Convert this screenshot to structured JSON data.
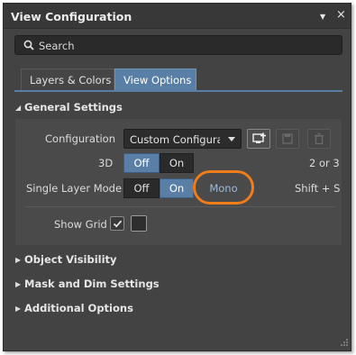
{
  "panel": {
    "title": "View Configuration",
    "controls": {
      "pin": "▼",
      "close": "×"
    }
  },
  "search": {
    "placeholder": "Search"
  },
  "tabs": [
    {
      "label": "Layers & Colors",
      "active": false
    },
    {
      "label": "View Options",
      "active": true
    }
  ],
  "general_settings": {
    "header": "General Settings",
    "expanded": true,
    "configuration": {
      "label": "Configuration",
      "value": "Custom Configurati"
    },
    "three_d": {
      "label": "3D",
      "off": "Off",
      "on": "On",
      "selected": "Off",
      "shortcut": "2 or 3"
    },
    "single_layer_mode": {
      "label": "Single Layer Mode",
      "off": "Off",
      "on": "On",
      "mono": "Mono",
      "selected": "On",
      "shortcut": "Shift + S"
    },
    "show_grid": {
      "label": "Show Grid",
      "checked": true
    }
  },
  "sections": [
    {
      "label": "Object Visibility",
      "expanded": false
    },
    {
      "label": "Mask and Dim Settings",
      "expanded": false
    },
    {
      "label": "Additional Options",
      "expanded": false
    }
  ],
  "colors": {
    "accent": "#5a7fa6",
    "highlight_ring": "#f07c1a",
    "panel_bg": "#434343"
  }
}
